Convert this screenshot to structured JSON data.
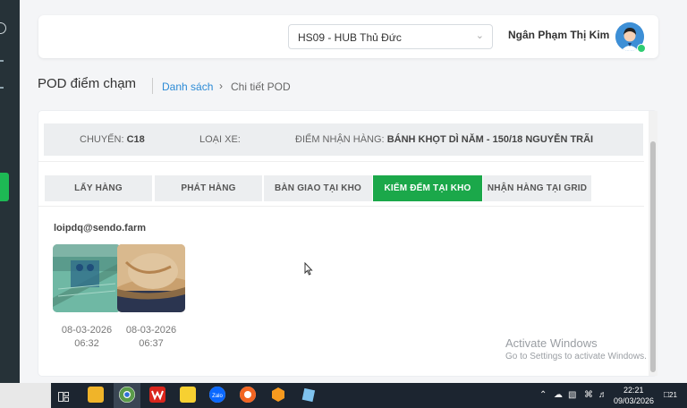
{
  "header": {
    "hub_select": "HS09 - HUB Thủ Đức",
    "user_name": "Ngân Phạm Thị Kim"
  },
  "page": {
    "title": "POD điểm chạm",
    "breadcrumb_list": "Danh sách",
    "breadcrumb_current": "Chi tiết POD"
  },
  "trip_info": {
    "trip_label": "CHUYẾN:",
    "trip_value": "C18",
    "vehicle_label": "LOẠI XE:",
    "vehicle_value": "",
    "pickup_label": "ĐIỂM NHẬN HÀNG:",
    "pickup_value": "BÁNH KHỌT DÌ NĂM - 150/18 NGUYỄN TRÃI"
  },
  "tabs": [
    {
      "label": "LẤY HÀNG",
      "active": false
    },
    {
      "label": "PHÁT HÀNG",
      "active": false
    },
    {
      "label": "BÀN GIAO TẠI KHO",
      "active": false
    },
    {
      "label": "KIỂM ĐẾM TẠI KHO",
      "active": true
    },
    {
      "label": "NHẬN HÀNG TẠI GRID",
      "active": false
    }
  ],
  "content": {
    "email": "loipdq@sendo.farm",
    "photos": [
      {
        "date": "08-03-2026",
        "time": "06:32"
      },
      {
        "date": "08-03-2026",
        "time": "06:37"
      }
    ]
  },
  "watermark": {
    "title": "Activate Windows",
    "subtitle": "Go to Settings to activate Windows."
  },
  "taskbar": {
    "time": "22:21",
    "date": "09/03/2026",
    "notification_count": "21"
  },
  "colors": {
    "accent": "#1ba84a",
    "link": "#2c8bd6",
    "sidebar": "#263238"
  }
}
